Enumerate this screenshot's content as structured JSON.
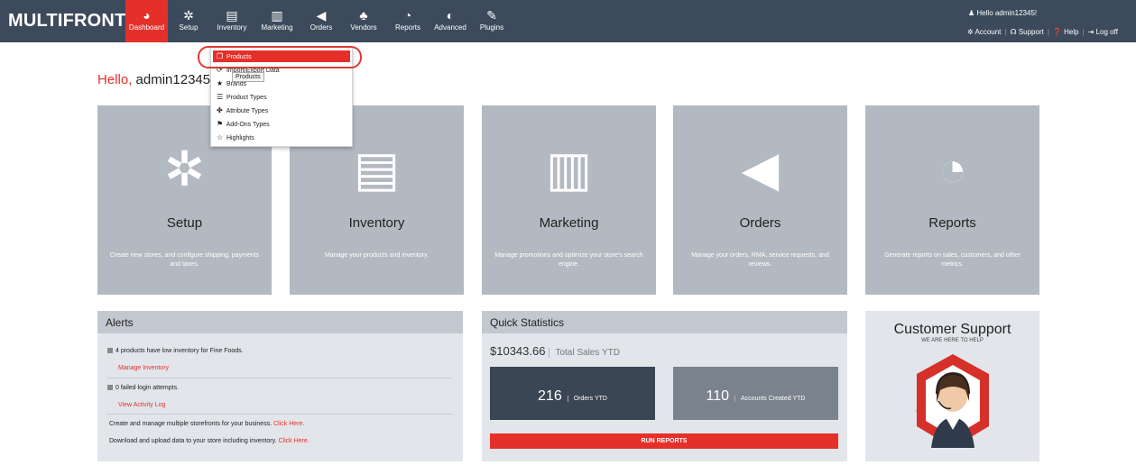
{
  "brand": "MULTIFRONT",
  "brand_mark": "®",
  "nav": [
    {
      "label": "Dashboard",
      "icon": "dashboard-icon",
      "glyph": "◕"
    },
    {
      "label": "Setup",
      "icon": "gear-icon",
      "glyph": "✲"
    },
    {
      "label": "Inventory",
      "icon": "clipboard-icon",
      "glyph": "▤"
    },
    {
      "label": "Marketing",
      "icon": "boxes-icon",
      "glyph": "▥"
    },
    {
      "label": "Orders",
      "icon": "megaphone-icon",
      "glyph": "◀"
    },
    {
      "label": "Vendors",
      "icon": "users-icon",
      "glyph": "♣"
    },
    {
      "label": "Reports",
      "icon": "pie-chart-icon",
      "glyph": "◔"
    },
    {
      "label": "Advanced",
      "icon": "compass-icon",
      "glyph": "◐"
    },
    {
      "label": "Plugins",
      "icon": "wrench-icon",
      "glyph": "✎"
    }
  ],
  "user": {
    "greeting": "Hello admin12345!",
    "icon": "user-icon",
    "glyph": "♟"
  },
  "top_links": {
    "account": "Account",
    "support": "Support",
    "help": "Help",
    "logoff": "Log off"
  },
  "hello": {
    "prefix": "Hello,",
    "name": "admin12345"
  },
  "dropdown": {
    "items": [
      {
        "label": "Products",
        "glyph": "❒",
        "icon": "box-icon"
      },
      {
        "label": "Import/Export Data",
        "glyph": "⟳",
        "icon": "sync-icon"
      },
      {
        "label": "Brands",
        "glyph": "★",
        "icon": "star-icon"
      },
      {
        "label": "Product Types",
        "glyph": "☰",
        "icon": "list-icon"
      },
      {
        "label": "Attribute Types",
        "glyph": "✤",
        "icon": "puzzle-icon"
      },
      {
        "label": "Add-Ons Types",
        "glyph": "⚑",
        "icon": "cart-plus-icon"
      },
      {
        "label": "Highlights",
        "glyph": "☆",
        "icon": "star-outline-icon"
      }
    ],
    "tooltip": "Products"
  },
  "tiles": [
    {
      "title": "Setup",
      "desc": "Create new stores, and configure shipping, payments and taxes.",
      "glyph": "✲",
      "icon": "gear-icon"
    },
    {
      "title": "Inventory",
      "desc": "Manage your products and inventory.",
      "glyph": "▤",
      "icon": "clipboard-check-icon"
    },
    {
      "title": "Marketing",
      "desc": "Manage promotions and optimize your store's search engine.",
      "glyph": "▥",
      "icon": "box-icon"
    },
    {
      "title": "Orders",
      "desc": "Manage your orders, RMA, service requests, and reviews.",
      "glyph": "◀",
      "icon": "megaphone-icon"
    },
    {
      "title": "Reports",
      "desc": "Generate reports on sales, customers, and other metrics.",
      "glyph": "◔",
      "icon": "pie-chart-icon"
    }
  ],
  "alerts": {
    "title": "Alerts",
    "low_inventory": "4 products have low inventory for Fine Foods.",
    "manage_inventory": "Manage Inventory",
    "failed_logins": "0 failed login attempts.",
    "view_log": "View Activity Log",
    "line1": "Create and manage multiple storefronts for your business.",
    "line2": "Download and upload data to your store including inventory.",
    "click_here": "Click Here."
  },
  "stats": {
    "title": "Quick Statistics",
    "total_sales": "$10343.66",
    "total_sales_label": "Total Sales YTD",
    "orders": "216",
    "orders_label": "Orders YTD",
    "accounts": "110",
    "accounts_label": "Accounts Created YTD",
    "run_reports": "RUN REPORTS"
  },
  "support": {
    "title": "Customer Support",
    "subtitle": "WE ARE HERE TO HELP"
  },
  "colors": {
    "accent": "#e5302a",
    "nav": "#3d4a5c",
    "tile": "#b3b9c0"
  }
}
